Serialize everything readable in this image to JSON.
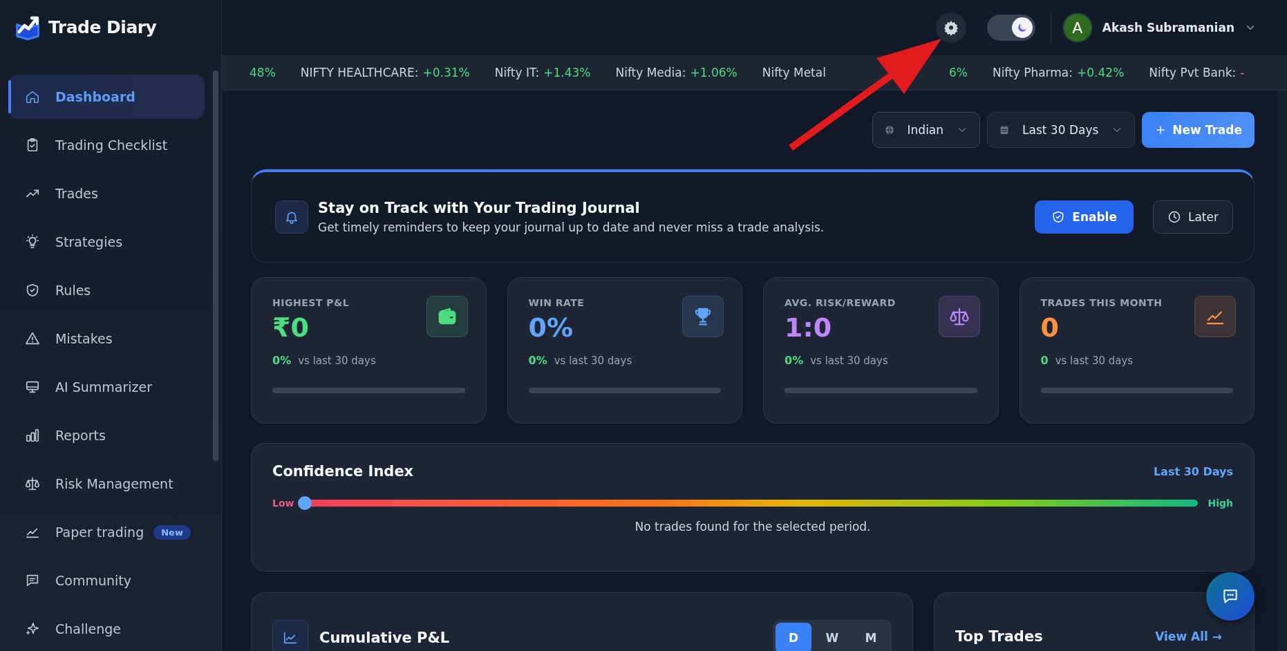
{
  "sidebar": {
    "brand": "Trade Diary",
    "items": [
      {
        "label": "Dashboard",
        "selected": true
      },
      {
        "label": "Trading Checklist",
        "selected": false
      },
      {
        "label": "Trades",
        "selected": false
      },
      {
        "label": "Strategies",
        "selected": false
      },
      {
        "label": "Rules",
        "selected": false
      },
      {
        "label": "Mistakes",
        "selected": false
      },
      {
        "label": "AI Summarizer",
        "selected": false
      },
      {
        "label": "Reports",
        "selected": false
      },
      {
        "label": "Risk Management",
        "selected": false
      },
      {
        "label": "Paper trading",
        "selected": false,
        "badge": "New"
      },
      {
        "label": "Community",
        "selected": false
      },
      {
        "label": "Challenge",
        "selected": false
      }
    ]
  },
  "header": {
    "theme_toggle": {
      "on": true
    },
    "user": {
      "initial": "A",
      "name": "Akash Subramanian"
    }
  },
  "ticker": [
    {
      "value": "48%",
      "color": "#4ade80"
    },
    {
      "label": "NIFTY HEALTHCARE:",
      "value": "+0.31%",
      "color": "#4ade80"
    },
    {
      "label": "Nifty IT:",
      "value": "+1.43%",
      "color": "#4ade80"
    },
    {
      "label": "Nifty Media:",
      "value": "+1.06%",
      "color": "#4ade80"
    },
    {
      "label": "Nifty Metal",
      "value": "6%",
      "color": "#4ade80"
    },
    {
      "label": "Nifty Pharma:",
      "value": "+0.42%",
      "color": "#4ade80"
    },
    {
      "label": "Nifty Pvt Bank:",
      "value": "-",
      "color": "#f87171"
    }
  ],
  "toolbar": {
    "market": "Indian",
    "period": "Last 30 Days",
    "new_trade": "New Trade"
  },
  "reminder": {
    "title": "Stay on Track with Your Trading Journal",
    "text": "Get timely reminders to keep your journal up to date and never miss a trade analysis.",
    "enable": "Enable",
    "later": "Later"
  },
  "stats": [
    {
      "label": "HIGHEST P&L",
      "value": "₹0",
      "color": "#4ade80",
      "change": "0%",
      "note": "vs last 30 days",
      "level": 0
    },
    {
      "label": "WIN RATE",
      "value": "0%",
      "color": "#60a5fa",
      "change": "0%",
      "note": "vs last 30 days",
      "level": 0
    },
    {
      "label": "AVG. RISK/REWARD",
      "value": "1:0",
      "color": "#c084fc",
      "change": "0%",
      "note": "vs last 30 days",
      "level": 0
    },
    {
      "label": "TRADES THIS MONTH",
      "value": "0",
      "color": "#fb923c",
      "change": "0",
      "note": "vs last 30 days",
      "level": 0
    }
  ],
  "confidence": {
    "title": "Confidence Index",
    "period": "Last 30 Days",
    "low": "Low",
    "high": "High",
    "level": 0,
    "message": "No trades found for the selected period."
  },
  "cumulative": {
    "title": "Cumulative P&L",
    "ranges": [
      {
        "label": "D",
        "selected": true
      },
      {
        "label": "W",
        "selected": false
      },
      {
        "label": "M",
        "selected": false
      }
    ]
  },
  "top_trades": {
    "title": "Top Trades",
    "link": "View All →"
  }
}
